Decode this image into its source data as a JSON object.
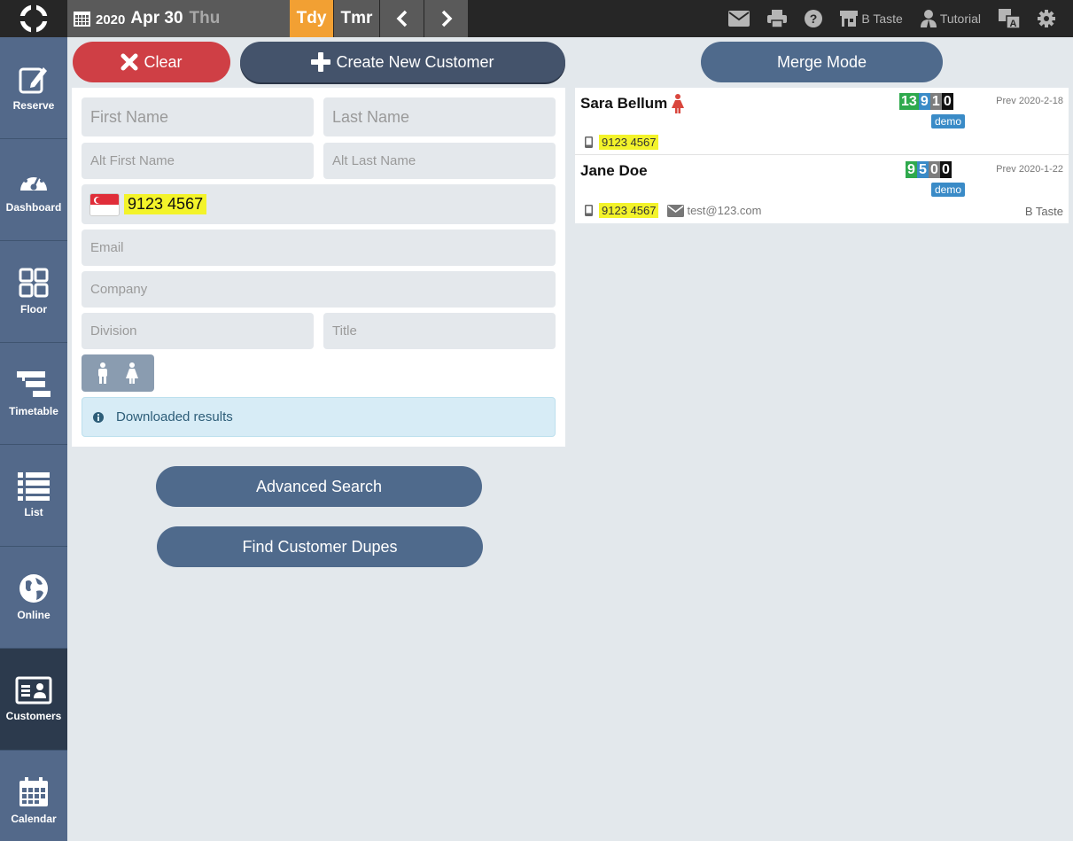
{
  "topbar": {
    "year": "2020",
    "month_day": "Apr 30",
    "weekday": "Thu",
    "today_label": "Tdy",
    "tomorrow_label": "Tmr",
    "venue_label": "B Taste",
    "tutorial_label": "Tutorial",
    "accent_color": "#f2a033"
  },
  "sidebar": {
    "items": [
      {
        "label": "Reserve",
        "icon": "edit-icon"
      },
      {
        "label": "Dashboard",
        "icon": "gauge-icon"
      },
      {
        "label": "Floor",
        "icon": "floor-grid-icon"
      },
      {
        "label": "Timetable",
        "icon": "timetable-icon"
      },
      {
        "label": "List",
        "icon": "list-icon"
      },
      {
        "label": "Online",
        "icon": "globe-icon"
      },
      {
        "label": "Customers",
        "icon": "id-card-icon"
      },
      {
        "label": "Calendar",
        "icon": "calendar-icon"
      }
    ],
    "active": "Customers"
  },
  "actions": {
    "clear_label": "Clear",
    "create_label": "Create New Customer",
    "merge_label": "Merge Mode",
    "advanced_search_label": "Advanced Search",
    "find_dupes_label": "Find Customer Dupes"
  },
  "form": {
    "first_name_placeholder": "First Name",
    "last_name_placeholder": "Last Name",
    "alt_first_name_placeholder": "Alt First Name",
    "alt_last_name_placeholder": "Alt Last Name",
    "phone_value": "9123 4567",
    "phone_country_icon": "singapore-flag-icon",
    "email_placeholder": "Email",
    "company_placeholder": "Company",
    "division_placeholder": "Division",
    "title_placeholder": "Title",
    "info_message": "Downloaded results"
  },
  "results": [
    {
      "name": "Sara Bellum",
      "gender_icon": "female-icon",
      "stats": [
        "13",
        "9",
        "1",
        "0"
      ],
      "prev": "Prev 2020-2-18",
      "tag": "demo",
      "phone": "9123 4567",
      "email": "",
      "venue": ""
    },
    {
      "name": "Jane Doe",
      "gender_icon": "",
      "stats": [
        "9",
        "5",
        "0",
        "0"
      ],
      "prev": "Prev 2020-1-22",
      "tag": "demo",
      "phone": "9123 4567",
      "email": "test@123.com",
      "venue": "B Taste"
    }
  ]
}
